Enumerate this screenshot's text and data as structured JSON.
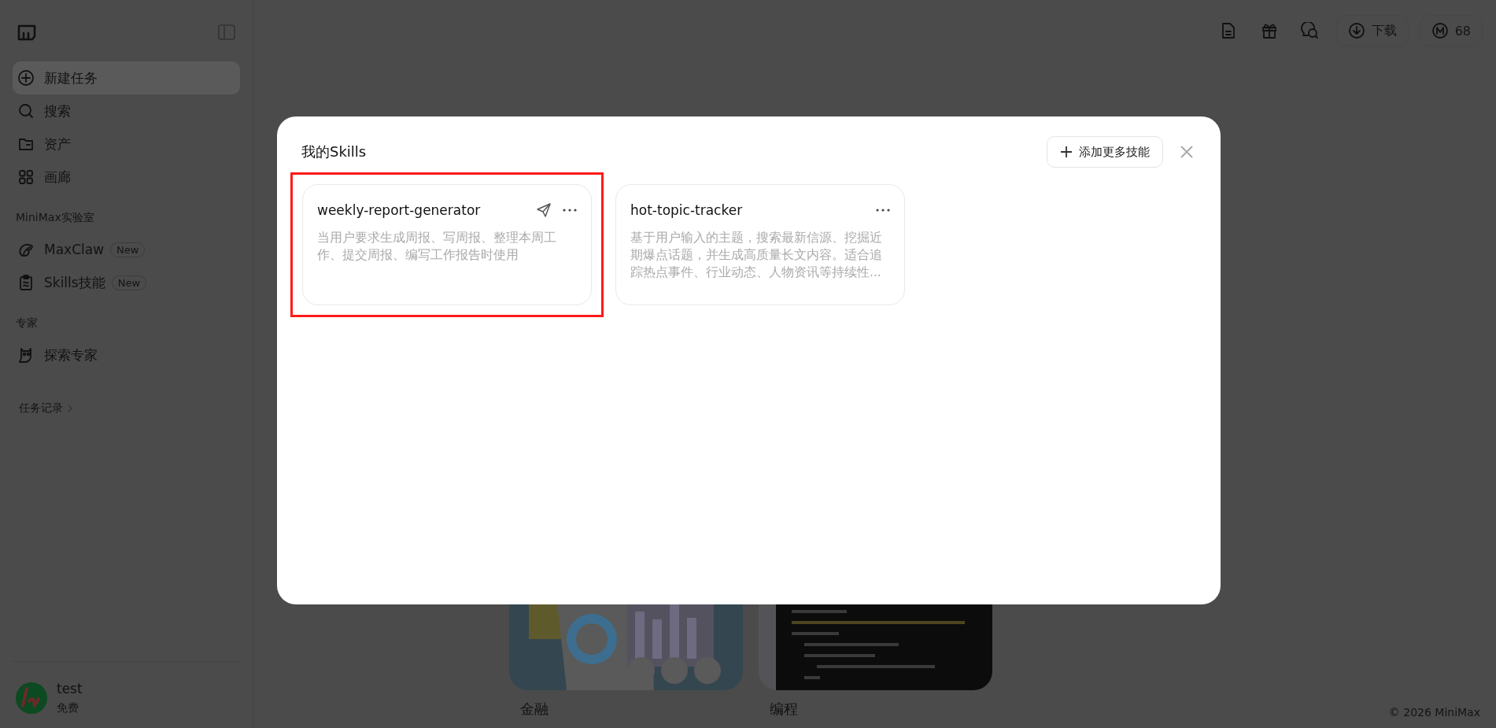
{
  "sidebar": {
    "nav": [
      {
        "label": "新建任务",
        "selected": true
      },
      {
        "label": "搜索",
        "selected": false
      },
      {
        "label": "资产",
        "selected": false
      },
      {
        "label": "画廊",
        "selected": false
      }
    ],
    "groups": [
      {
        "heading": "MiniMax实验室",
        "items": [
          {
            "label": "MaxClaw",
            "badge": "New"
          },
          {
            "label": "Skills技能",
            "badge": "New"
          }
        ]
      },
      {
        "heading": "专家",
        "items": [
          {
            "label": "探索专家"
          }
        ]
      }
    ],
    "history_link": "任务记录",
    "user": {
      "name": "test",
      "plan": "免费"
    }
  },
  "topbar": {
    "download": "下载",
    "credits": "68"
  },
  "gallery": [
    {
      "label": "金融",
      "kind": "picture"
    },
    {
      "label": "编程",
      "kind": "picture"
    }
  ],
  "footer": "© 2026 MiniMax",
  "modal": {
    "title": "我的Skills",
    "add_button": "添加更多技能",
    "skills": [
      {
        "name": "weekly-report-generator",
        "description": "当用户要求生成周报、写周报、整理本周工作、提交周报、编写工作报告时使用",
        "highlighted": true
      },
      {
        "name": "hot-topic-tracker",
        "description": "基于用户输入的主题，搜索最新信源、挖掘近期爆点话题，并生成高质量长文内容。适合追踪热点事件、行业动态、人物资讯等持续性...",
        "highlighted": false
      }
    ]
  }
}
